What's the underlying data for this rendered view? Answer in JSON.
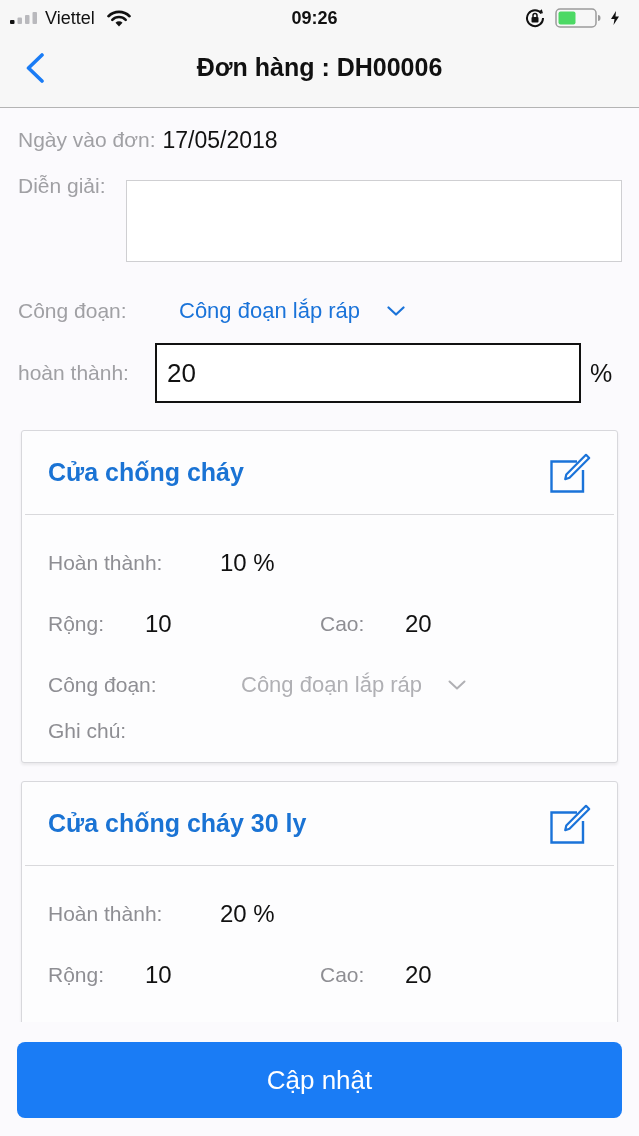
{
  "status_bar": {
    "carrier": "Viettel",
    "time": "09:26"
  },
  "nav": {
    "title": "Đơn hàng : DH00006"
  },
  "form": {
    "date": {
      "label": "Ngày vào đơn:",
      "value": "17/05/2018"
    },
    "description": {
      "label": "Diễn giải:"
    },
    "stage": {
      "label": "Công đoạn:",
      "value": "Công đoạn lắp ráp",
      "disabled": false
    },
    "completion": {
      "label": "hoàn thành:",
      "value": "20",
      "unit": "%"
    }
  },
  "items": [
    {
      "title": "Cửa chống cháy",
      "fields": [
        {
          "kind": "percent",
          "label": "Hoàn thành:",
          "value": "10 %"
        },
        {
          "kind": "pair",
          "label": "Rộng:",
          "value": "10",
          "label_2": "Cao:",
          "value_2": "20"
        },
        {
          "kind": "select",
          "label": "Công đoạn:",
          "value": "Công đoạn lắp ráp",
          "disabled": true
        },
        {
          "kind": "note",
          "label": "Ghi chú:"
        }
      ]
    },
    {
      "title": "Cửa chống cháy 30 ly",
      "fields": [
        {
          "kind": "percent",
          "label": "Hoàn thành:",
          "value": "20 %"
        },
        {
          "kind": "pair",
          "label": "Rộng:",
          "value": "10",
          "label_2": "Cao:",
          "value_2": "20"
        }
      ]
    }
  ],
  "update_button": {
    "label": "Cập nhật"
  }
}
